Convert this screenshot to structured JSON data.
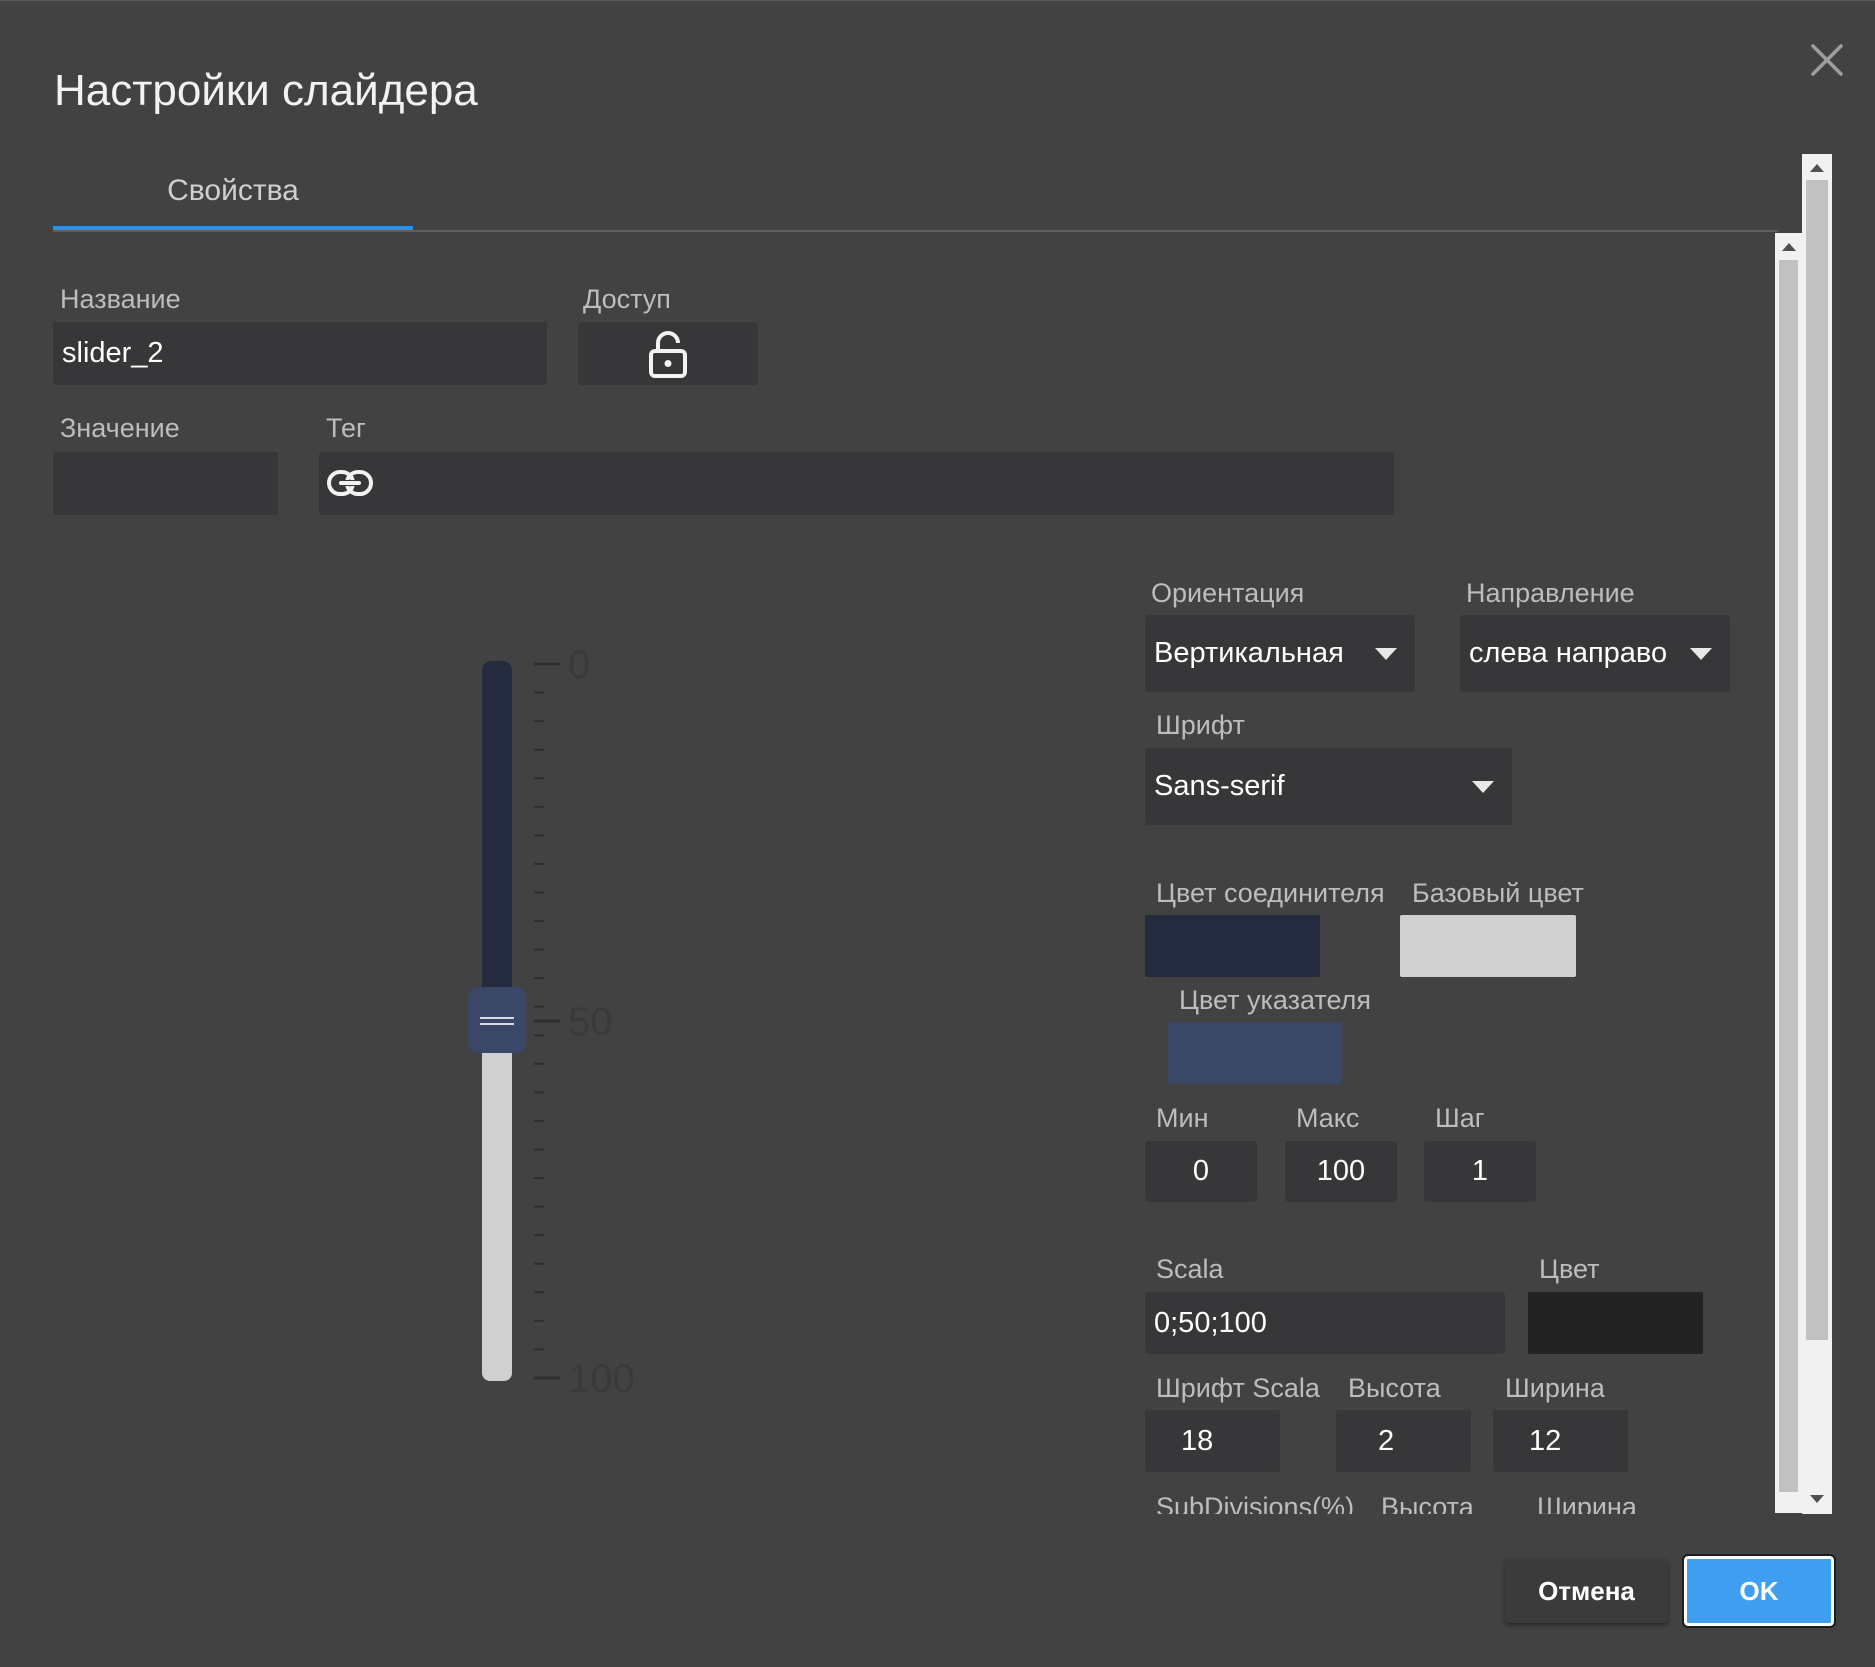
{
  "dialog": {
    "title": "Настройки слайдера",
    "tab": "Свойства"
  },
  "name": {
    "label": "Название",
    "value": "slider_2"
  },
  "access": {
    "label": "Доступ",
    "icon": "unlock-icon"
  },
  "value_field": {
    "label": "Значение",
    "value": ""
  },
  "tag": {
    "label": "Тег",
    "value": "",
    "icon": "link-icon"
  },
  "orientation": {
    "label": "Ориентация",
    "selected": "Вертикальная"
  },
  "direction": {
    "label": "Направление",
    "selected": "слева направо"
  },
  "font": {
    "label": "Шрифт",
    "selected": "Sans-serif"
  },
  "colors": {
    "connector_label": "Цвет соединителя",
    "connector": "#252b3f",
    "base_label": "Базовый цвет",
    "base": "#d0d0d0",
    "pointer_label": "Цвет указателя",
    "pointer": "#3b4766"
  },
  "range": {
    "min_label": "Мин",
    "min": "0",
    "max_label": "Макс",
    "max": "100",
    "step_label": "Шаг",
    "step": "1"
  },
  "scala": {
    "label": "Scala",
    "value": "0;50;100",
    "color_label": "Цвет",
    "color": "#232323",
    "font_label": "Шрифт Scala",
    "font": "18",
    "height_label": "Высота",
    "height": "2",
    "width_label": "Ширина",
    "width": "12"
  },
  "subdivisions": {
    "label": "SubDivisions(%)",
    "height_label": "Высота",
    "width_label": "Ширина"
  },
  "preview": {
    "ticks": [
      "0",
      "50",
      "100"
    ],
    "value": 50,
    "min": 0,
    "max": 100,
    "minor_step": 4
  },
  "buttons": {
    "cancel": "Отмена",
    "ok": "OK"
  }
}
